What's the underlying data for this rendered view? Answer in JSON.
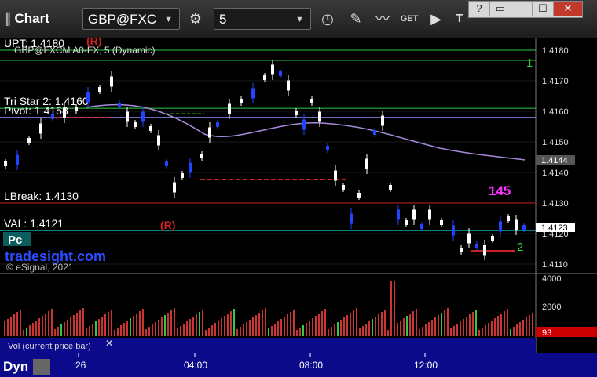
{
  "app": {
    "title": "Chart"
  },
  "toolbar": {
    "symbol": "GBP@FXC",
    "interval": "5",
    "buttons": [
      "gear-icon",
      "clock-icon",
      "pencil-icon",
      "study-icon",
      "get-icon",
      "play-icon",
      "text-icon"
    ]
  },
  "window_controls": [
    "?",
    "▭",
    "—",
    "☐",
    "✕"
  ],
  "chart": {
    "series_label": "GBP@FXCM A0-FX, 5 (Dynamic)",
    "watermark": "tradesight.com",
    "copyright": "© eSignal, 2021",
    "levels": [
      {
        "label": "UPT: 1.4180",
        "value": 1.418,
        "color": "#2ecc40"
      },
      {
        "label": "Tri Star 2: 1.4160",
        "value": 1.4161,
        "color": "#2ecc40"
      },
      {
        "label": "Pivot: 1.4158",
        "value": 1.4158,
        "color": "#9090ff"
      },
      {
        "label": "LBreak: 1.4130",
        "value": 1.413,
        "color": "#cc2222"
      },
      {
        "label": "VAL: 1.4121",
        "value": 1.4121,
        "color": "#00cccc"
      }
    ],
    "price_axis": [
      "1.4180",
      "1.4170",
      "1.4160",
      "1.4150",
      "1.4140",
      "1.4130",
      "1.4120",
      "1.4110"
    ],
    "last_price": "1.4123",
    "ma_value": "1.4144",
    "time_axis": [
      "26",
      "04:00",
      "08:00",
      "12:00"
    ],
    "markers": {
      "r_top": "(R)",
      "r_bottom": "(R)",
      "num_1": "1",
      "num_2": "2",
      "magenta": "145",
      "pc": "Pc"
    },
    "volume": {
      "title": "Vol (current price bar)",
      "axis": [
        "4000",
        "2000"
      ],
      "current": "93",
      "panel_label": "Dyn"
    }
  },
  "colors": {
    "ma": "#a78bdb",
    "candle_up": "#ffffff",
    "candle_down": "#2244ff",
    "volume_bar": "#cc3333",
    "volume_hi": "#2ecc40"
  }
}
